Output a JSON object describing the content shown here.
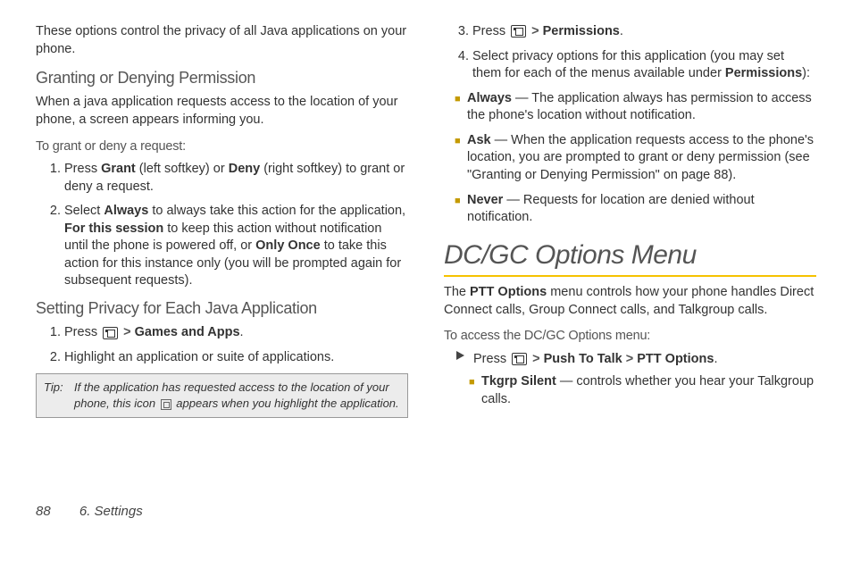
{
  "left": {
    "intro": "These options control the privacy of all Java applications on your phone.",
    "h_grant": "Granting or Denying Permission",
    "grant_intro": "When a java application requests access to the location of your phone, a screen appears informing you.",
    "grant_lead": "To grant or deny a request:",
    "step1_a": "Press ",
    "step1_grant": "Grant",
    "step1_b": " (left softkey) or ",
    "step1_deny": "Deny",
    "step1_c": " (right softkey) to grant or deny a request.",
    "step2_a": "Select ",
    "step2_always": "Always",
    "step2_b": " to always take this action for the application, ",
    "step2_session": "For this session",
    "step2_c": " to keep this action without notification until the phone is powered off, or ",
    "step2_once": "Only Once",
    "step2_d": " to take this action for this instance only (you will be prompted again for subsequent requests).",
    "h_priv": "Setting Privacy for Each Java Application",
    "priv_step1_a": "Press ",
    "priv_step1_gt": ">",
    "priv_step1_games": "Games and Apps",
    "priv_step1_dot": ".",
    "priv_step2": "Highlight an application or suite of applications.",
    "tip_label": "Tip:",
    "tip_a": "If the application has requested access to the location of your phone, this icon ",
    "tip_b": " appears when you highlight the application."
  },
  "right": {
    "step3_a": "Press ",
    "step3_gt": ">",
    "step3_perm": "Permissions",
    "step3_dot": ".",
    "step4_a": "Select privacy options for this application (you may set them for each of the menus available under ",
    "step4_perm": "Permissions",
    "step4_b": "):",
    "bul_always_l": "Always",
    "bul_always_t": " — The application always has permission to access the phone's location without notification.",
    "bul_ask_l": "Ask",
    "bul_ask_t": " — When the application requests access to the phone's location, you are prompted to grant or deny permission (see \"Granting or Denying Permission\" on page 88).",
    "bul_never_l": "Never",
    "bul_never_t": " — Requests for location are denied without notification.",
    "h_dcgc": "DC/GC Options Menu",
    "dcgc_intro_a": "The ",
    "dcgc_intro_ptt": "PTT Options",
    "dcgc_intro_b": " menu controls how your phone handles Direct Connect calls, Group Connect calls, and Talkgroup calls.",
    "dcgc_lead": "To access the DC/GC Options menu:",
    "dcgc_step_a": "Press ",
    "dcgc_step_gt1": ">",
    "dcgc_step_ptt": "Push To Talk",
    "dcgc_step_gt2": ">",
    "dcgc_step_opt": "PTT Options",
    "dcgc_step_dot": ".",
    "bul_tkgrp_l": "Tkgrp Silent",
    "bul_tkgrp_t": " — controls whether you hear your Talkgroup calls."
  },
  "footer": {
    "page": "88",
    "chapter": "6. Settings"
  }
}
